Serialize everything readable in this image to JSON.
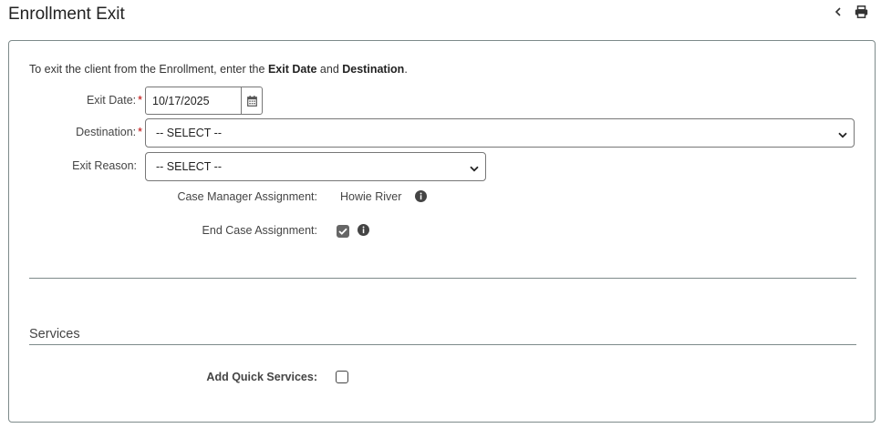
{
  "page": {
    "title": "Enrollment Exit"
  },
  "header": {
    "back_icon": "chevron-left-icon",
    "print_icon": "print-icon"
  },
  "intro": {
    "prefix": "To exit the client from the Enrollment, enter the ",
    "exit_date_bold": "Exit Date",
    "and": " and ",
    "destination_bold": "Destination",
    "suffix": "."
  },
  "form": {
    "exit_date": {
      "label": "Exit Date:",
      "required_mark": "*",
      "value": "10/17/2025",
      "icon": "calendar-icon"
    },
    "destination": {
      "label": "Destination:",
      "required_mark": "*",
      "selected": "-- SELECT --"
    },
    "exit_reason": {
      "label": "Exit Reason:",
      "selected": "-- SELECT --"
    },
    "case_manager": {
      "label": "Case Manager Assignment:",
      "value": "Howie River",
      "icon": "info-icon"
    },
    "end_case": {
      "label": "End Case Assignment:",
      "checked": true,
      "icon": "info-icon"
    }
  },
  "services": {
    "title": "Services",
    "add_quick_label": "Add Quick Services:",
    "add_quick_checked": false
  },
  "colors": {
    "border": "#7d8a8a",
    "required": "#bb0000",
    "checkbox_fill": "#666666"
  }
}
